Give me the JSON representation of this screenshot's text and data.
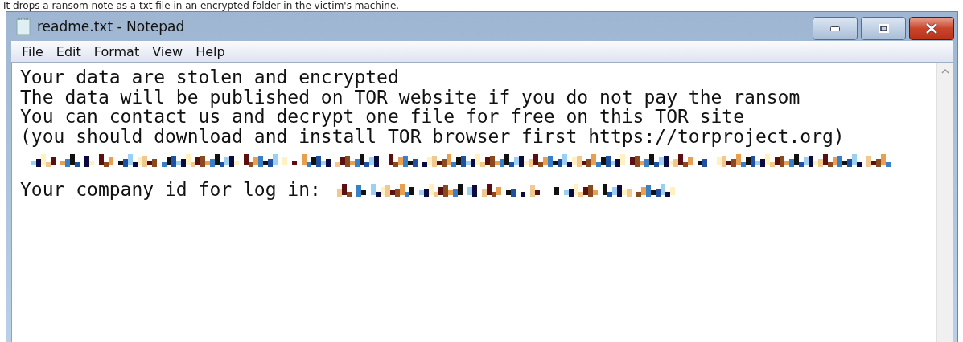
{
  "caption": "It drops a ransom note as a txt file in an encrypted folder in the victim's machine.",
  "window": {
    "title": "readme.txt - Notepad"
  },
  "menu": [
    "File",
    "Edit",
    "Format",
    "View",
    "Help"
  ],
  "lines": [
    {
      "kind": "text",
      "text": "Your data are stolen and encrypted"
    },
    {
      "kind": "text",
      "text": "The data will be published on TOR website if you do not pay the ransom"
    },
    {
      "kind": "text",
      "text": "You can contact us and decrypt one file for free on this TOR site"
    },
    {
      "kind": "text",
      "text": "(you should download and install TOR browser first https://torproject.org)"
    },
    {
      "kind": "redacted"
    },
    {
      "kind": "text_redacted",
      "text": "Your company id for log in:"
    }
  ]
}
